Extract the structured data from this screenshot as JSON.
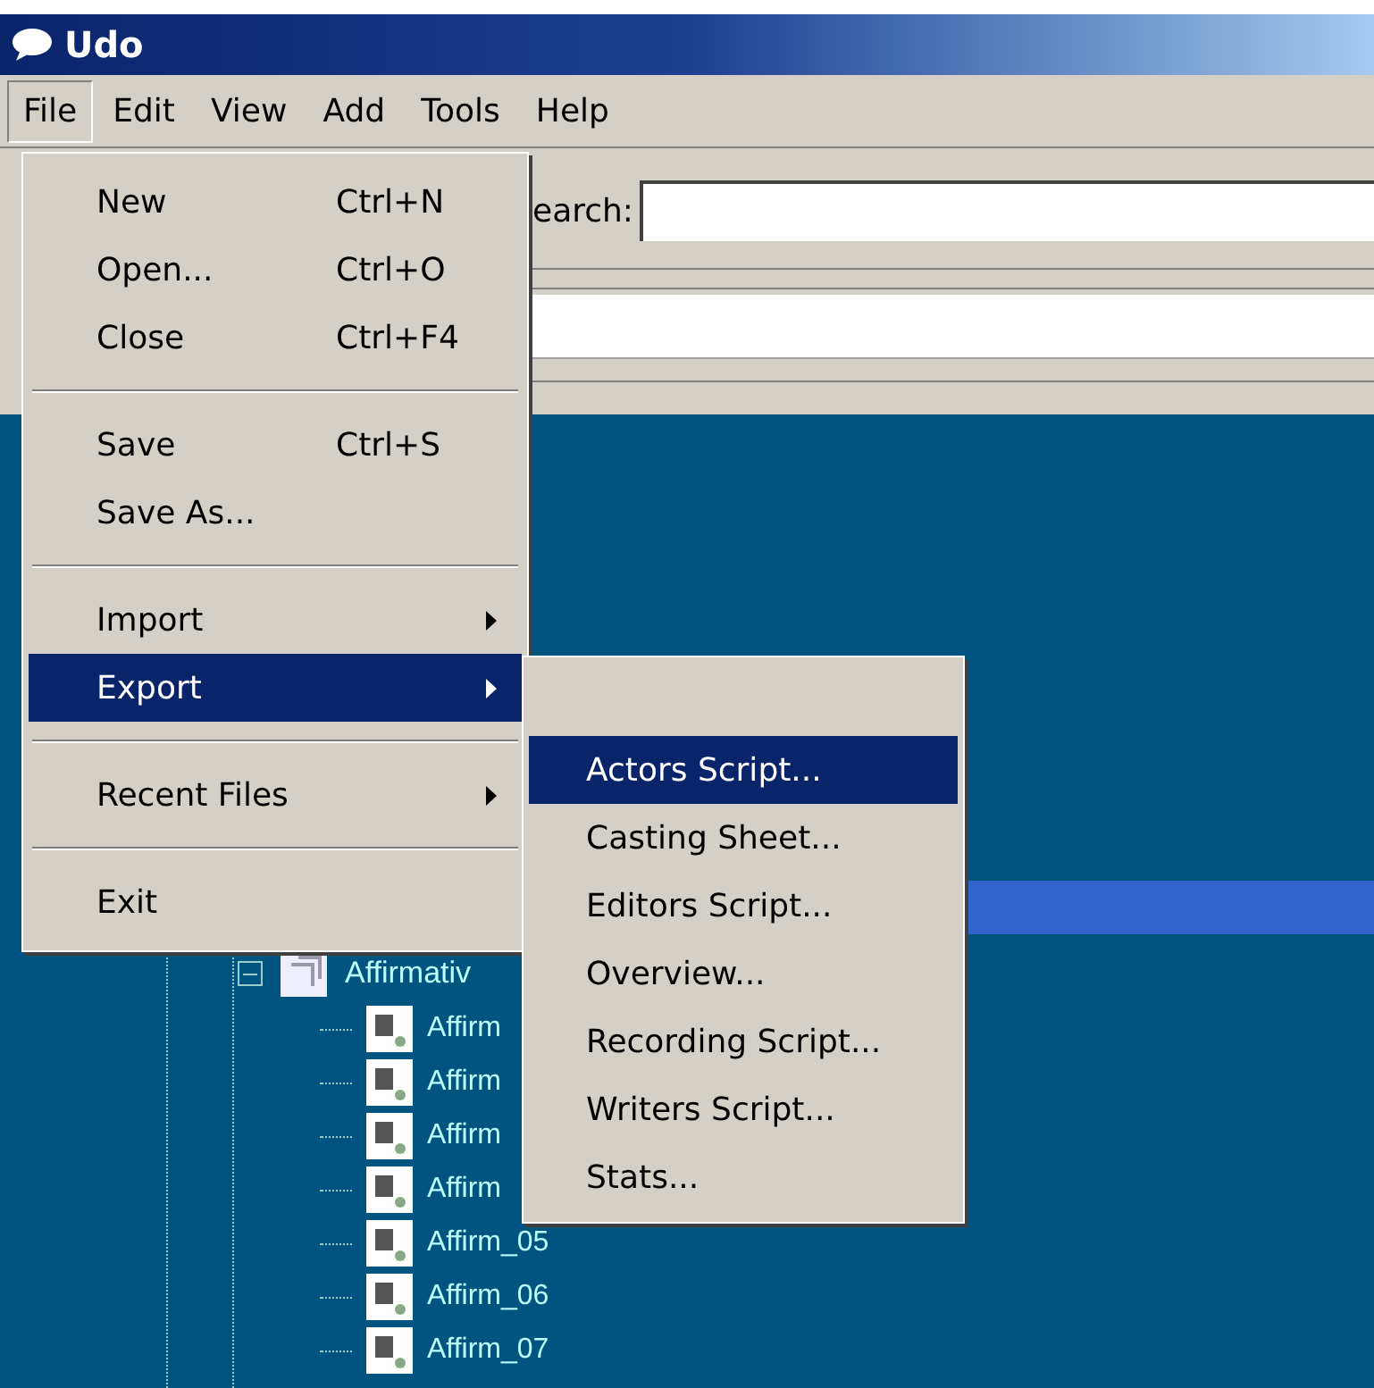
{
  "window": {
    "title": "Udo"
  },
  "menu_bar": [
    {
      "label": "File",
      "selected": true
    },
    {
      "label": "Edit",
      "selected": false
    },
    {
      "label": "View",
      "selected": false
    },
    {
      "label": "Add",
      "selected": false
    },
    {
      "label": "Tools",
      "selected": false
    },
    {
      "label": "Help",
      "selected": false
    }
  ],
  "search": {
    "label": "earch:"
  },
  "file_menu": [
    {
      "kind": "item",
      "label": "New",
      "shortcut": "Ctrl+N",
      "selected": false
    },
    {
      "kind": "item",
      "label": "Open...",
      "shortcut": "Ctrl+O",
      "selected": false
    },
    {
      "kind": "item",
      "label": "Close",
      "shortcut": "Ctrl+F4",
      "selected": false
    },
    {
      "kind": "separator"
    },
    {
      "kind": "item",
      "label": "Save",
      "shortcut": "Ctrl+S",
      "selected": false
    },
    {
      "kind": "item",
      "label": "Save As...",
      "selected": false
    },
    {
      "kind": "separator"
    },
    {
      "kind": "submenu",
      "label": "Import",
      "selected": false
    },
    {
      "kind": "submenu",
      "label": "Export",
      "selected": true
    },
    {
      "kind": "separator"
    },
    {
      "kind": "submenu",
      "label": "Recent Files",
      "selected": false
    },
    {
      "kind": "separator"
    },
    {
      "kind": "item",
      "label": "Exit",
      "selected": false
    }
  ],
  "export_menu": [
    {
      "label": "Actors Script...",
      "selected": true
    },
    {
      "label": "Casting Sheet...",
      "selected": false
    },
    {
      "label": "Editors Script...",
      "selected": false
    },
    {
      "label": "Overview...",
      "selected": false
    },
    {
      "label": "Recording Script...",
      "selected": false
    },
    {
      "label": "Writers Script...",
      "selected": false
    },
    {
      "label": "Stats...",
      "selected": false
    }
  ],
  "tree": [
    {
      "label": "Affirmativ",
      "expanded": true,
      "children": [
        {
          "label": "Affirm"
        },
        {
          "label": "Affirm"
        },
        {
          "label": "Affirm"
        },
        {
          "label": "Affirm"
        },
        {
          "label": "Affirm_05"
        },
        {
          "label": "Affirm_06"
        },
        {
          "label": "Affirm_07"
        }
      ]
    }
  ]
}
